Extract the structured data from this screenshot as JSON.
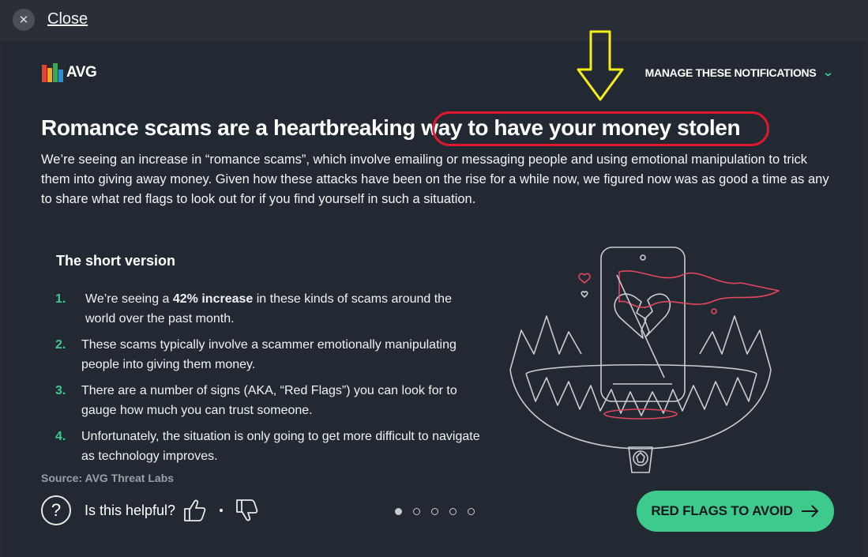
{
  "topbar": {
    "close_label": "Close"
  },
  "brand": {
    "logo_text": "AVG",
    "manage_label": "MANAGE THESE NOTIFICATIONS"
  },
  "article": {
    "title": "Romance scams are a heartbreaking way to have your money stolen",
    "intro": "We’re seeing an increase in “romance scams”, which involve emailing or messaging people and using emotional manipulation to trick them into giving away money. Given how these attacks have been on the rise for a while now, we figured now was as good a time as any to share what red flags to look out for if you find yourself in such a situation.",
    "short_title": "The short version",
    "items": [
      {
        "num": "1.",
        "before": "We’re seeing a ",
        "bold": "42% increase",
        "after": " in these kinds of scams around the world over the past month."
      },
      {
        "num": "2.",
        "text": "These scams typically involve a scammer emotionally manipulating people into giving them money."
      },
      {
        "num": "3.",
        "text": "There are a number of signs (AKA, “Red Flags”) you can look for to gauge how much you can trust someone."
      },
      {
        "num": "4.",
        "text": "Unfortunately, the situation is only going to get more difficult to navigate as technology improves."
      }
    ],
    "source": "Source: AVG Threat Labs"
  },
  "feedback": {
    "question_mark": "?",
    "label": "Is this helpful?"
  },
  "pagination": {
    "total": 5,
    "active_index": 0
  },
  "cta": {
    "label": "RED FLAGS TO AVOID"
  },
  "colors": {
    "accent": "#3ec98d",
    "highlight": "#e0182d",
    "annotation_arrow": "#f5ee14",
    "background": "#232933"
  }
}
